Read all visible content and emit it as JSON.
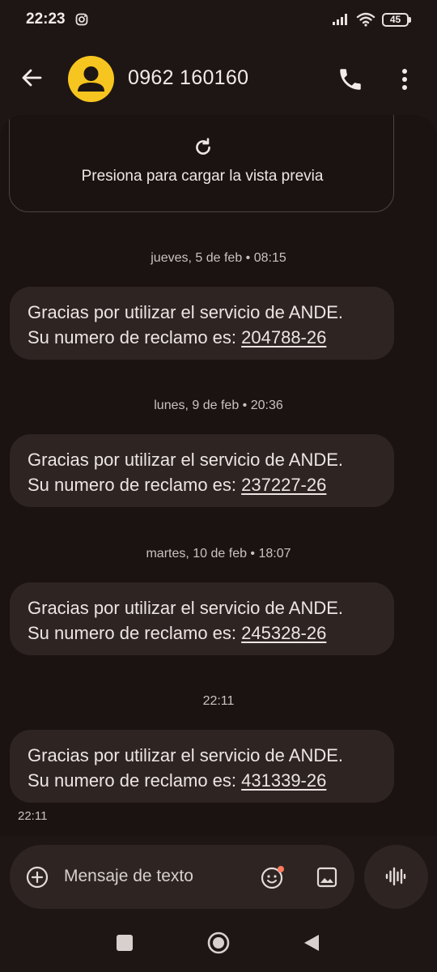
{
  "status_bar": {
    "time": "22:23",
    "battery": "45",
    "icons": [
      "instagram-icon",
      "signal-icon",
      "wifi-icon",
      "battery-icon"
    ]
  },
  "header": {
    "contact": "0962 160160",
    "avatar_color": "#f7c51f",
    "icons": [
      "back-arrow-icon",
      "phone-icon",
      "more-vert-icon"
    ]
  },
  "preview": {
    "text": "Presiona para cargar la vista previa"
  },
  "messages": [
    {
      "date": "jueves, 5 de feb • 08:15",
      "line1": "Gracias por utilizar el servicio de ANDE.",
      "line2_prefix": "Su numero de reclamo es: ",
      "code": "204788-26"
    },
    {
      "date": "lunes, 9 de feb • 20:36",
      "line1": "Gracias por utilizar el servicio de ANDE.",
      "line2_prefix": "Su numero de reclamo es: ",
      "code": "237227-26"
    },
    {
      "date": "martes, 10 de feb • 18:07",
      "line1": "Gracias por utilizar el servicio de ANDE.",
      "line2_prefix": "Su numero de reclamo es: ",
      "code": "245328-26"
    },
    {
      "date": "22:11",
      "line1": "Gracias por utilizar el servicio de ANDE.",
      "line2_prefix": "Su numero de reclamo es: ",
      "code": "431339-26"
    }
  ],
  "last_time": "22:11",
  "compose": {
    "placeholder": "Mensaje de texto",
    "icons": [
      "add-icon",
      "emoji-icon",
      "image-icon",
      "voice-icon"
    ]
  },
  "colors": {
    "background": "#1e1614",
    "bubble": "#2e2523",
    "accent": "#f7c51f",
    "notification_dot": "#ff7a5c"
  }
}
